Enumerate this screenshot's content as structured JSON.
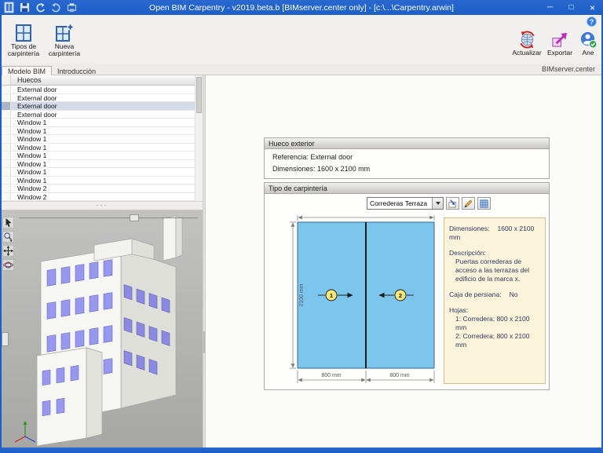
{
  "colors": {
    "titlebar_blue": "#1b5fc8",
    "leaf_fill": "#7cc6ee",
    "info_panel_bg": "#fbf3da",
    "window_glass": "#9898ef",
    "selection_row": "#d2dbe7"
  },
  "titlebar": {
    "title": "Open BIM Carpentry - v2019.beta.b [BIMserver.center only] - [c:\\...\\Carpentry.arwin]",
    "minimize_glyph": "─",
    "maximize_glyph": "□",
    "close_glyph": "×"
  },
  "ribbon": {
    "tipos_carpinteria": "Tipos de carpintería",
    "nueva_carpinteria": "Nueva carpintería",
    "actualizar": "Actualizar",
    "exportar": "Exportar",
    "ane": "Ane",
    "bimserver_center": "BIMserver.center",
    "help_glyph": "?"
  },
  "tabs": {
    "modelo_bim": "Modelo BIM",
    "introduccion": "Introducción"
  },
  "huecos_table": {
    "header": "Huecos",
    "splitter_dots": "···",
    "rows": [
      {
        "label": "External door",
        "selected": false
      },
      {
        "label": "External door",
        "selected": false
      },
      {
        "label": "External door",
        "selected": true
      },
      {
        "label": "External door",
        "selected": false
      },
      {
        "label": "Window 1",
        "selected": false
      },
      {
        "label": "Window 1",
        "selected": false
      },
      {
        "label": "Window 1",
        "selected": false
      },
      {
        "label": "Window 1",
        "selected": false
      },
      {
        "label": "Window 1",
        "selected": false
      },
      {
        "label": "Window 1",
        "selected": false
      },
      {
        "label": "Window 1",
        "selected": false
      },
      {
        "label": "Window 1",
        "selected": false
      },
      {
        "label": "Window 2",
        "selected": false
      },
      {
        "label": "Window 2",
        "selected": false
      }
    ]
  },
  "hueco_exterior": {
    "title": "Hueco exterior",
    "referencia_label": "Referencia:",
    "referencia_value": "External door",
    "dimensiones_label": "Dimensiones:",
    "dimensiones_value": "1600 x 2100 mm"
  },
  "tipo_carpinteria": {
    "title": "Tipo de carpintería",
    "selector_value": "Correderas Terraza",
    "drawing": {
      "height_dim": "2100 mm",
      "leaf1_width": "800 mm",
      "leaf2_width": "800 mm",
      "leaf1_num": "1",
      "leaf2_num": "2"
    },
    "info": {
      "dimensiones_label": "Dimensiones:",
      "dimensiones_value": "1600 x 2100 mm",
      "descripcion_label": "Descripción:",
      "descripcion_text": "Puertas correderas de acceso a las terrazas del edificio de la marca x.",
      "caja_label": "Caja de persiana:",
      "caja_value": "No",
      "hojas_label": "Hojas:",
      "hojas": [
        "1: Corredera; 800 x 2100 mm",
        "2: Corredera; 800 x 2100 mm"
      ]
    }
  }
}
